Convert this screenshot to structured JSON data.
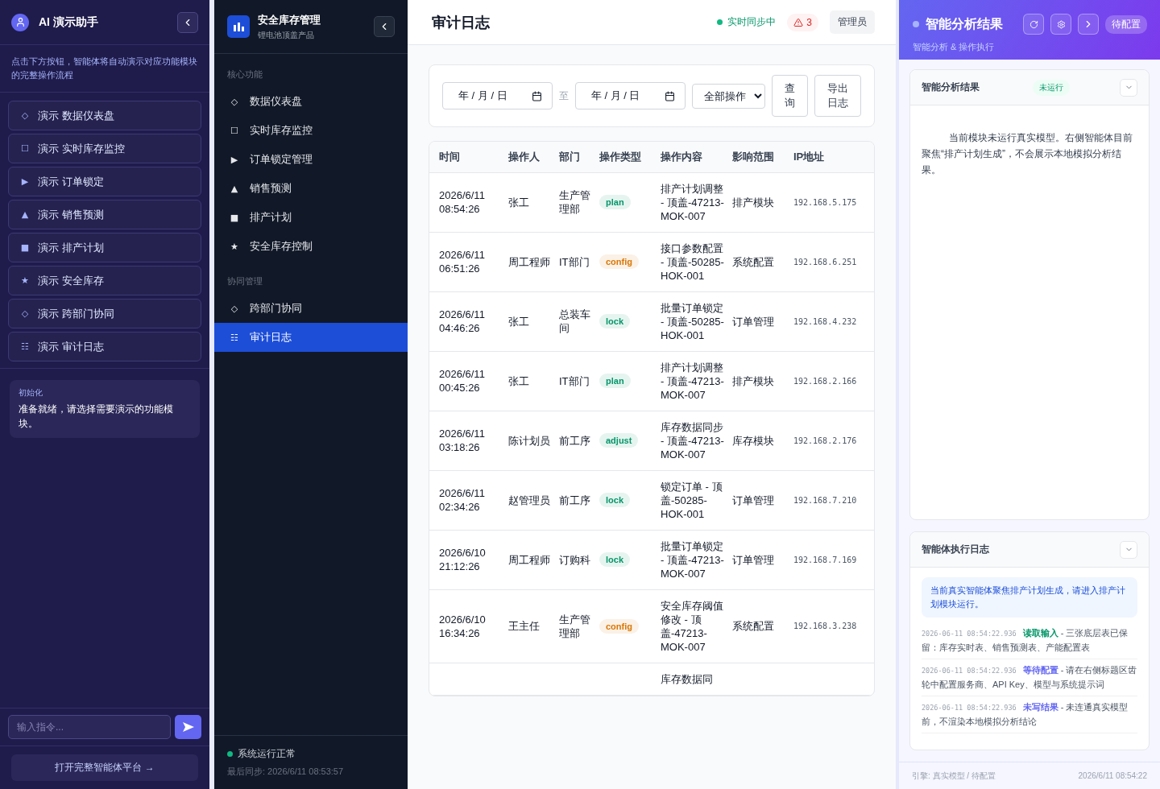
{
  "assistant": {
    "title": "AI 演示助手",
    "description": "点击下方按钮，智能体将自动演示对应功能模块的完整操作流程",
    "demos": [
      {
        "icon": "◇",
        "label": "演示 数据仪表盘"
      },
      {
        "icon": "☐",
        "label": "演示 实时库存监控"
      },
      {
        "icon": "▶",
        "label": "演示 订单锁定"
      },
      {
        "icon": "▲",
        "label": "演示 销售预测"
      },
      {
        "icon": "■",
        "label": "演示 排产计划"
      },
      {
        "icon": "★",
        "label": "演示 安全库存"
      },
      {
        "icon": "◇",
        "label": "演示 跨部门协同"
      },
      {
        "icon": "☷",
        "label": "演示 审计日志"
      }
    ],
    "status": {
      "label": "初始化",
      "message": "准备就绪，请选择需要演示的功能模块。"
    },
    "input": {
      "placeholder": "输入指令..."
    },
    "platform_button": "打开完整智能体平台 →"
  },
  "nav": {
    "title": "安全库存管理",
    "subtitle": "锂电池顶盖产品",
    "sections": [
      {
        "label": "核心功能",
        "items": [
          {
            "icon": "◇",
            "label": "数据仪表盘",
            "selected": false
          },
          {
            "icon": "☐",
            "label": "实时库存监控",
            "selected": false
          },
          {
            "icon": "▶",
            "label": "订单锁定管理",
            "selected": false
          },
          {
            "icon": "▲",
            "label": "销售预测",
            "selected": false
          },
          {
            "icon": "■",
            "label": "排产计划",
            "selected": false
          },
          {
            "icon": "★",
            "label": "安全库存控制",
            "selected": false
          }
        ]
      },
      {
        "label": "协同管理",
        "items": [
          {
            "icon": "◇",
            "label": "跨部门协同",
            "selected": false
          },
          {
            "icon": "☷",
            "label": "审计日志",
            "selected": true
          }
        ]
      }
    ],
    "footer": {
      "status": "系统运行正常",
      "last_sync": "最后同步: 2026/6/11 08:53:57"
    }
  },
  "header": {
    "title": "审计日志",
    "sync_status": "实时同步中",
    "alert_count": "3",
    "user": "管理员"
  },
  "filters": {
    "date_from": "年  / 月 / 日",
    "separator": "至",
    "date_to": "年  / 月 / 日",
    "operation": "全部操作",
    "query_button": "查询",
    "export_button": "导出日志"
  },
  "table": {
    "columns": [
      "时间",
      "操作人",
      "部门",
      "操作类型",
      "操作内容",
      "影响范围",
      "IP地址"
    ],
    "rows": [
      {
        "time": "2026/6/11 08:54:26",
        "operator": "张工",
        "department": "生产管理部",
        "type": "plan",
        "color": "#059669",
        "content": "排产计划调整 - 顶盖-47213-MOK-007",
        "scope": "排产模块",
        "ip": "192.168.5.175"
      },
      {
        "time": "2026/6/11 06:51:26",
        "operator": "周工程师",
        "department": "IT部门",
        "type": "config",
        "color": "#d97706",
        "content": "接口参数配置 - 顶盖-50285-HOK-001",
        "scope": "系统配置",
        "ip": "192.168.6.251"
      },
      {
        "time": "2026/6/11 04:46:26",
        "operator": "张工",
        "department": "总装车间",
        "type": "lock",
        "color": "#059669",
        "content": "批量订单锁定 - 顶盖-50285-HOK-001",
        "scope": "订单管理",
        "ip": "192.168.4.232"
      },
      {
        "time": "2026/6/11 00:45:26",
        "operator": "张工",
        "department": "IT部门",
        "type": "plan",
        "color": "#059669",
        "content": "排产计划调整 - 顶盖-47213-MOK-007",
        "scope": "排产模块",
        "ip": "192.168.2.166"
      },
      {
        "time": "2026/6/11 03:18:26",
        "operator": "陈计划员",
        "department": "前工序",
        "type": "adjust",
        "color": "#059669",
        "content": "库存数据同步 - 顶盖-47213-MOK-007",
        "scope": "库存模块",
        "ip": "192.168.2.176"
      },
      {
        "time": "2026/6/11 02:34:26",
        "operator": "赵管理员",
        "department": "前工序",
        "type": "lock",
        "color": "#059669",
        "content": "锁定订单 - 顶盖-50285-HOK-001",
        "scope": "订单管理",
        "ip": "192.168.7.210"
      },
      {
        "time": "2026/6/10 21:12:26",
        "operator": "周工程师",
        "department": "订购科",
        "type": "lock",
        "color": "#059669",
        "content": "批量订单锁定 - 顶盖-47213-MOK-007",
        "scope": "订单管理",
        "ip": "192.168.7.169"
      },
      {
        "time": "2026/6/10 16:34:26",
        "operator": "王主任",
        "department": "生产管理部",
        "type": "config",
        "color": "#d97706",
        "content": "安全库存阈值修改 - 顶盖-47213-MOK-007",
        "scope": "系统配置",
        "ip": "192.168.3.238"
      },
      {
        "content": "库存数据同"
      }
    ]
  },
  "analysis": {
    "title": "智能分析结果",
    "subtitle": "智能分析 & 操作执行",
    "config_badge": "待配置",
    "result_card": {
      "title": "智能分析结果",
      "status": "未运行",
      "body": "当前模块未运行真实模型。右侧智能体目前聚焦“排产计划生成”，不会展示本地模拟分析结果。"
    },
    "log_card": {
      "title": "智能体执行日志",
      "notice": "当前真实智能体聚焦排产计划生成，请进入排产计划模块运行。",
      "entries": [
        {
          "time": "2026-06-11 08:54:22.936",
          "action": "读取输入",
          "color": "#059669",
          "text": " - 三张底层表已保留：库存实时表、销售预测表、产能配置表"
        },
        {
          "time": "2026-06-11 08:54:22.936",
          "action": "等待配置",
          "color": "#6366f1",
          "text": " - 请在右侧标题区齿轮中配置服务商、API Key、模型与系统提示词"
        },
        {
          "time": "2026-06-11 08:54:22.936",
          "action": "未写结果",
          "color": "#6366f1",
          "text": " - 未连通真实模型前，不渲染本地模拟分析结论"
        }
      ]
    },
    "engine": "引擎: 真实模型 / 待配置",
    "timestamp": "2026/6/11 08:54:22"
  }
}
